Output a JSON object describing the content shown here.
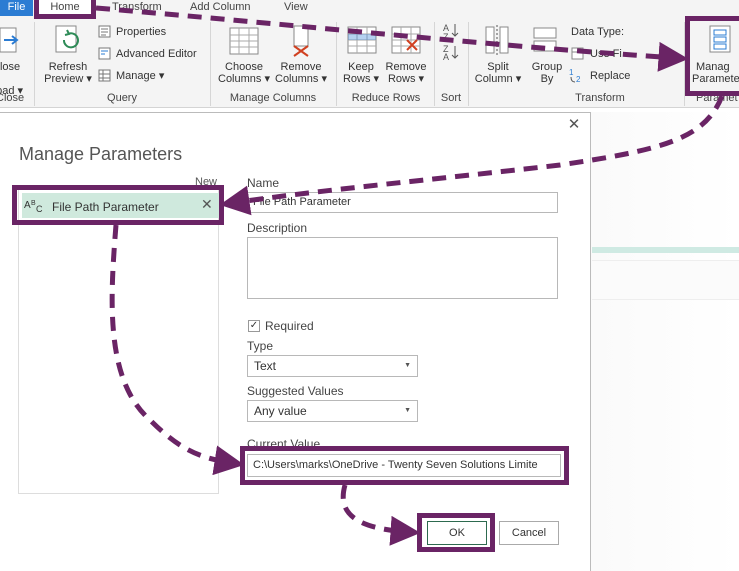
{
  "ribbon": {
    "tabs": {
      "file": "File",
      "home": "Home",
      "transform": "Transform",
      "add_column": "Add Column",
      "view": "View"
    },
    "close_group": {
      "btn_line1": "Close &",
      "btn_line2": "Load",
      "label": "Close"
    },
    "query_group": {
      "refresh_line1": "Refresh",
      "refresh_line2": "Preview",
      "properties": "Properties",
      "advanced_editor": "Advanced Editor",
      "manage": "Manage",
      "label": "Query"
    },
    "manage_columns_group": {
      "choose_line1": "Choose",
      "choose_line2": "Columns",
      "remove_line1": "Remove",
      "remove_line2": "Columns",
      "label": "Manage Columns"
    },
    "reduce_rows_group": {
      "keep_line1": "Keep",
      "keep_line2": "Rows",
      "remove_line1": "Remove",
      "remove_line2": "Rows",
      "label": "Reduce Rows"
    },
    "sort_group": {
      "label": "Sort"
    },
    "transform_group": {
      "split_line1": "Split",
      "split_line2": "Column",
      "group_line1": "Group",
      "group_line2": "By",
      "data_type": "Data Type:",
      "use_first": "Use Fi",
      "replace": "Replace",
      "label": "Transform"
    },
    "parameters_group": {
      "manage_line1": "Manag",
      "manage_line2": "Paramete",
      "label": "Paramet"
    }
  },
  "dialog": {
    "title": "Manage Parameters",
    "new_link": "New",
    "parameters": [
      {
        "name": "File Path Parameter",
        "type_icon": "abc-text-icon"
      }
    ],
    "name_label": "Name",
    "name_value": "File Path Parameter",
    "description_label": "Description",
    "description_value": "",
    "required_label": "Required",
    "required_checked": true,
    "type_label": "Type",
    "type_value": "Text",
    "suggested_label": "Suggested Values",
    "suggested_value": "Any value",
    "current_label": "Current Value",
    "current_value": "C:\\Users\\marks\\OneDrive - Twenty Seven Solutions Limite",
    "ok_label": "OK",
    "cancel_label": "Cancel"
  },
  "annotation_color": "#6a2465",
  "accent_color": "#2b7cd3"
}
